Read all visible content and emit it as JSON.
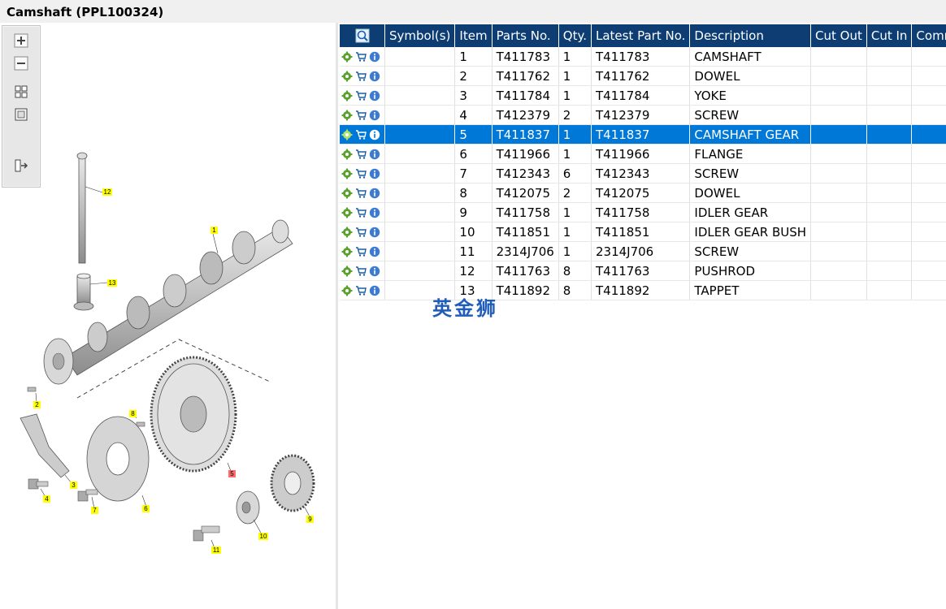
{
  "window": {
    "title": "Camshaft (PPL100324)"
  },
  "table": {
    "headers": {
      "symbols": "Symbol(s)",
      "item": "Item",
      "parts_no": "Parts No.",
      "qty": "Qty.",
      "latest": "Latest Part No.",
      "description": "Description",
      "cut_out": "Cut Out",
      "cut_in": "Cut In",
      "comment": "Comment"
    },
    "selected_item": "5",
    "rows": [
      {
        "item": "1",
        "parts_no": "T411783",
        "qty": "1",
        "latest": "T411783",
        "description": "CAMSHAFT"
      },
      {
        "item": "2",
        "parts_no": "T411762",
        "qty": "1",
        "latest": "T411762",
        "description": "DOWEL"
      },
      {
        "item": "3",
        "parts_no": "T411784",
        "qty": "1",
        "latest": "T411784",
        "description": "YOKE"
      },
      {
        "item": "4",
        "parts_no": "T412379",
        "qty": "2",
        "latest": "T412379",
        "description": "SCREW"
      },
      {
        "item": "5",
        "parts_no": "T411837",
        "qty": "1",
        "latest": "T411837",
        "description": "CAMSHAFT GEAR"
      },
      {
        "item": "6",
        "parts_no": "T411966",
        "qty": "1",
        "latest": "T411966",
        "description": "FLANGE"
      },
      {
        "item": "7",
        "parts_no": "T412343",
        "qty": "6",
        "latest": "T412343",
        "description": "SCREW"
      },
      {
        "item": "8",
        "parts_no": "T412075",
        "qty": "2",
        "latest": "T412075",
        "description": "DOWEL"
      },
      {
        "item": "9",
        "parts_no": "T411758",
        "qty": "1",
        "latest": "T411758",
        "description": "IDLER GEAR"
      },
      {
        "item": "10",
        "parts_no": "T411851",
        "qty": "1",
        "latest": "T411851",
        "description": "IDLER GEAR BUSH"
      },
      {
        "item": "11",
        "parts_no": "2314J706",
        "qty": "1",
        "latest": "2314J706",
        "description": "SCREW"
      },
      {
        "item": "12",
        "parts_no": "T411763",
        "qty": "8",
        "latest": "T411763",
        "description": "PUSHROD"
      },
      {
        "item": "13",
        "parts_no": "T411892",
        "qty": "8",
        "latest": "T411892",
        "description": "TAPPET"
      }
    ]
  },
  "diagram": {
    "callouts": [
      "1",
      "2",
      "3",
      "4",
      "5",
      "6",
      "7",
      "8",
      "9",
      "10",
      "11",
      "12",
      "13"
    ],
    "highlighted_callout": "5"
  },
  "watermark": "英金狮",
  "icons": {
    "header": "zoom-find-icon",
    "row": [
      "gear-icon",
      "cart-icon",
      "info-icon"
    ],
    "toolbar": [
      "zoom-in-icon",
      "zoom-out-icon",
      "fit-all-icon",
      "fit-page-icon",
      "export-icon"
    ]
  },
  "colors": {
    "header_bg": "#0d3d73",
    "selected_row": "#0078d7",
    "callout_yellow": "#ffff00",
    "callout_highlight": "#ff6b6b"
  }
}
